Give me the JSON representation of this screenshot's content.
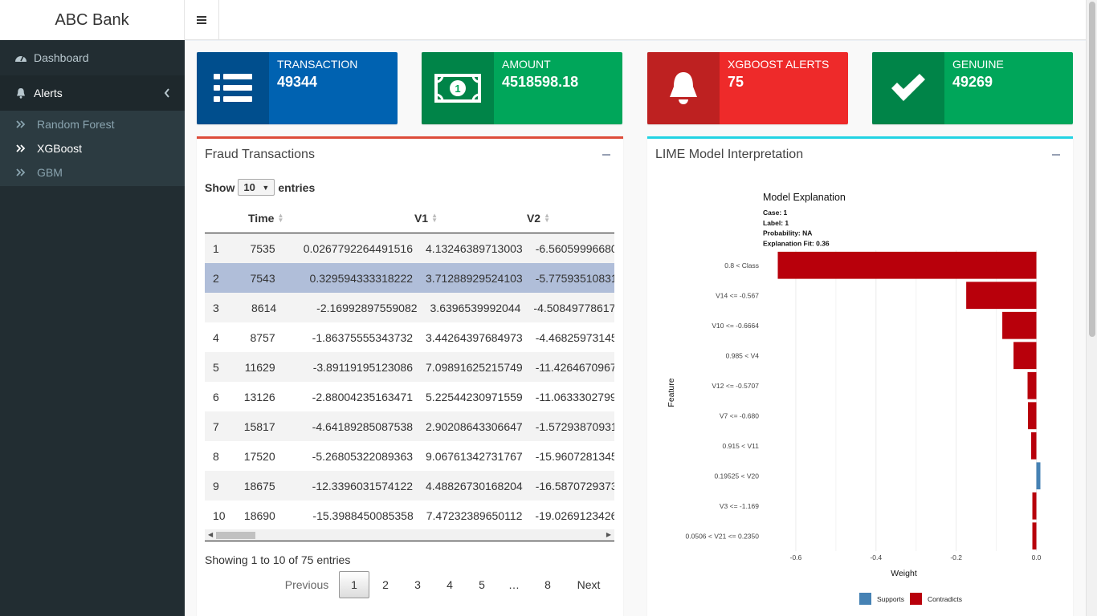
{
  "app": {
    "title": "ABC Bank"
  },
  "sidebar": {
    "items": [
      {
        "label": "Dashboard"
      },
      {
        "label": "Alerts"
      }
    ],
    "subitems": [
      {
        "label": "Random Forest"
      },
      {
        "label": "XGBoost"
      },
      {
        "label": "GBM"
      }
    ]
  },
  "infoboxes": [
    {
      "label": "TRANSACTION",
      "value": "49344",
      "color": "#0062b1"
    },
    {
      "label": "AMOUNT",
      "value": "4518598.18",
      "color": "#00a65a"
    },
    {
      "label": "XGBOOST ALERTS",
      "value": "75",
      "color": "#ee2a2a"
    },
    {
      "label": "GENUINE",
      "value": "49269",
      "color": "#00a65a"
    }
  ],
  "fraud": {
    "title": "Fraud Transactions",
    "show_label": "Show",
    "entries_value": "10",
    "entries_label": "entries",
    "columns": [
      "",
      "Time",
      "V1",
      "V2",
      ""
    ],
    "rows": [
      [
        "1",
        "7535",
        "0.0267792264491516",
        "4.13246389713003",
        "-6.56059996680"
      ],
      [
        "2",
        "7543",
        "0.329594333318222",
        "3.71288929524103",
        "-5.77593510831"
      ],
      [
        "3",
        "8614",
        "-2.16992897559082",
        "3.6396539992044",
        "-4.50849778617"
      ],
      [
        "4",
        "8757",
        "-1.86375555343732",
        "3.44264397684973",
        "-4.46825973145"
      ],
      [
        "5",
        "11629",
        "-3.89119195123086",
        "7.09891625215749",
        "-11.4264670967"
      ],
      [
        "6",
        "13126",
        "-2.88004235163471",
        "5.22544230971559",
        "-11.0633302799"
      ],
      [
        "7",
        "15817",
        "-4.64189285087538",
        "2.90208643306647",
        "-1.57293870931"
      ],
      [
        "8",
        "17520",
        "-5.26805322089363",
        "9.06761342731767",
        "-15.9607281345"
      ],
      [
        "9",
        "18675",
        "-12.3396031574122",
        "4.48826730168204",
        "-16.5870729373"
      ],
      [
        "10",
        "18690",
        "-15.3988450085358",
        "7.47232389650112",
        "-19.0269123426"
      ]
    ],
    "info": "Showing 1 to 10 of 75 entries",
    "pagination": [
      "Previous",
      "1",
      "2",
      "3",
      "4",
      "5",
      "…",
      "8",
      "Next"
    ]
  },
  "lime": {
    "title": "LIME Model Interpretation"
  },
  "chart_data": {
    "type": "bar",
    "title": "Model Explanation",
    "subtitle_lines": [
      "Case: 1",
      "Label: 1",
      "Probability: NA",
      "Explanation Fit: 0.36"
    ],
    "xlabel": "Weight",
    "ylabel": "Feature",
    "xlim": [
      -0.65,
      0.0
    ],
    "xticks": [
      "-0.6",
      "-0.4",
      "-0.2",
      "0.0"
    ],
    "xtick_values": [
      -0.6,
      -0.4,
      -0.2,
      0.0
    ],
    "categories": [
      "0.8 < Class",
      "V14 <= -0.567",
      "V10 <= -0.6664",
      "0.985 < V4",
      "V12 <= -0.5707",
      "V7 <= -0.680",
      "0.915 < V11",
      "0.19525 < V20",
      "V3 <= -1.169",
      "0.0506 < V21 <= 0.2350"
    ],
    "values": [
      -0.645,
      -0.175,
      -0.085,
      -0.057,
      -0.022,
      -0.021,
      -0.013,
      0.01,
      -0.01,
      -0.01
    ],
    "legend": [
      {
        "name": "Supports",
        "color": "#4682b4"
      },
      {
        "name": "Contradicts",
        "color": "#b8000b"
      }
    ],
    "legend_position": "bottom",
    "grid": true
  }
}
